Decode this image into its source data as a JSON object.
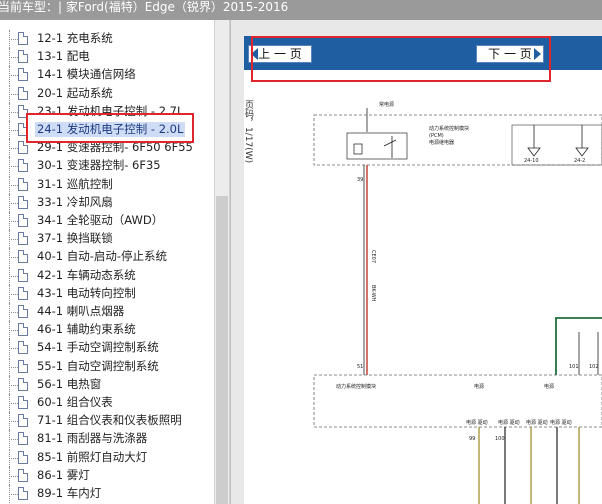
{
  "window": {
    "title": "当前车型：| 家Ford(福特）Edge（锐界）2015-2016"
  },
  "tree": {
    "items": [
      {
        "label": "12-1 充电系统"
      },
      {
        "label": "13-1 配电"
      },
      {
        "label": "14-1 模块通信网络"
      },
      {
        "label": "20-1 起动系统"
      },
      {
        "label": "23-1 发动机电子控制 - 2.7L"
      },
      {
        "label": "24-1 发动机电子控制 - 2.0L"
      },
      {
        "label": "29-1 变速器控制- 6F50 6F55"
      },
      {
        "label": "30-1 变速器控制- 6F35"
      },
      {
        "label": "31-1 巡航控制"
      },
      {
        "label": "33-1 冷却风扇"
      },
      {
        "label": "34-1 全轮驱动（AWD）"
      },
      {
        "label": "37-1 换挡联锁"
      },
      {
        "label": "40-1 自动-启动-停止系统"
      },
      {
        "label": "42-1 车辆动态系统"
      },
      {
        "label": "43-1 电动转向控制"
      },
      {
        "label": "44-1 喇叭点烟器"
      },
      {
        "label": "46-1 辅助约束系统"
      },
      {
        "label": "54-1 手动空调控制系统"
      },
      {
        "label": "55-1 自动空调控制系统"
      },
      {
        "label": "56-1 电热窗"
      },
      {
        "label": "60-1 组合仪表"
      },
      {
        "label": "71-1 组合仪表和仪表板照明"
      },
      {
        "label": "81-1 雨刮器与洗涤器"
      },
      {
        "label": "85-1 前照灯自动大灯"
      },
      {
        "label": "86-1 雾灯"
      },
      {
        "label": "89-1 车内灯"
      }
    ],
    "selected_index": 5
  },
  "viewer": {
    "prev_label": "上 一 页",
    "next_label": "下 一 页",
    "page_label": "页码，1/17(W)"
  },
  "schematic": {
    "top_label": "常电源",
    "module_label_1": "动力系统控制模块",
    "module_label_2": "(PCM)",
    "module_label_3": "电源继电器",
    "ground_1": "24-10",
    "ground_2": "24-2",
    "wire_1": "CE07",
    "wire_1b": "BK-WH",
    "pin_39": "39",
    "pin_51": "51",
    "bottom_box_label": "动力系统控制模块",
    "bottom_label_a": "电源",
    "bottom_label_b": "电源",
    "feed_1": "电源 驱动",
    "feed_2": "电源 驱动",
    "feed_3": "电源 驱动",
    "feed_4": "电源 驱动",
    "pin_101": "101",
    "pin_102": "102",
    "pin_99": "99",
    "pin_100": "100",
    "colors": {
      "nav_blue": "#1f5ea0",
      "highlight_red": "#e0262a",
      "wire_red": "#c0392b",
      "wire_green": "#1f6e3a"
    }
  }
}
